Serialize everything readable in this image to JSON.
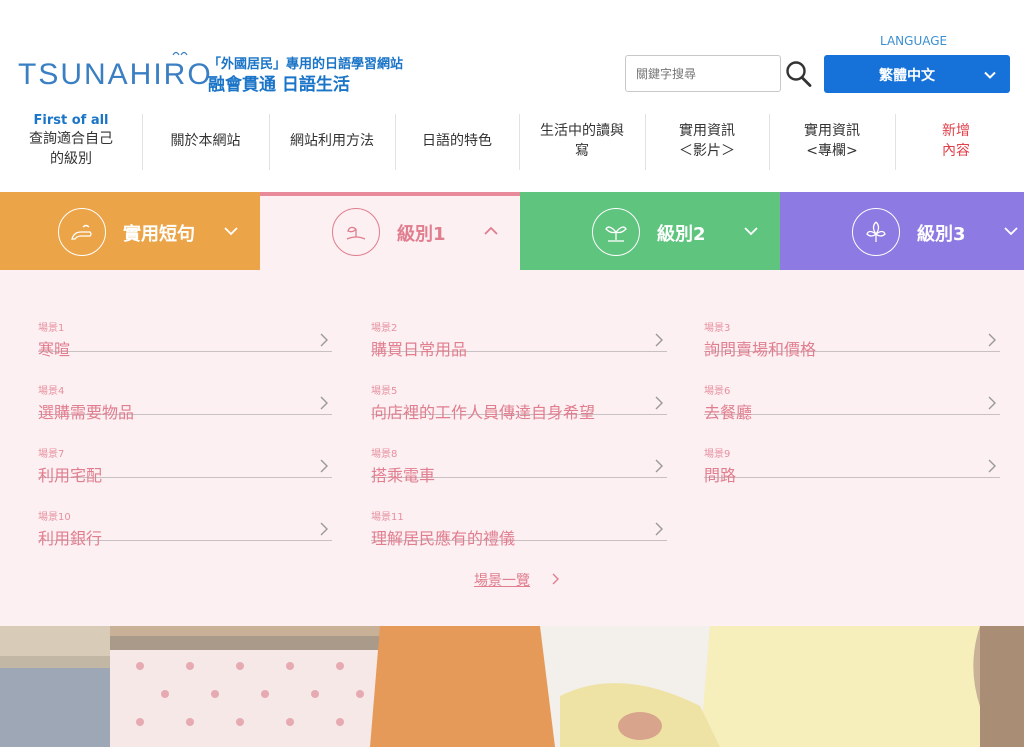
{
  "header": {
    "logo": "TSUNAHIRO",
    "tagline_line1": "「外國居民」專用的日語學習網站",
    "tagline_line2": "融會貫通 日語生活",
    "search_placeholder": "關鍵字搜尋",
    "language_label": "LANGUAGE",
    "language_selected": "繁體中文"
  },
  "nav": [
    {
      "pre": "First of all",
      "label": "查詢適合自己",
      "label2": "的級別"
    },
    {
      "label": "關於本網站"
    },
    {
      "label": "網站利用方法"
    },
    {
      "label": "日語的特色"
    },
    {
      "label": "生活中的讀與",
      "label2": "寫"
    },
    {
      "label": "實用資訊",
      "label2": "＜影片＞"
    },
    {
      "label": "實用資訊",
      "label2": "<專欄>"
    },
    {
      "label": "新增",
      "label2": "內容"
    }
  ],
  "tabs": [
    {
      "label": "實用短句",
      "icon": "speech-icon"
    },
    {
      "label": "級別1",
      "icon": "sprout-icon"
    },
    {
      "label": "級別2",
      "icon": "seedling-icon"
    },
    {
      "label": "級別3",
      "icon": "tree-icon"
    }
  ],
  "scenes": [
    {
      "num": "場景1",
      "title": "寒暄"
    },
    {
      "num": "場景2",
      "title": "購買日常用品"
    },
    {
      "num": "場景3",
      "title": "詢問賣場和價格"
    },
    {
      "num": "場景4",
      "title": "選購需要物品"
    },
    {
      "num": "場景5",
      "title": "向店裡的工作人員傳達自身希望"
    },
    {
      "num": "場景6",
      "title": "去餐廳"
    },
    {
      "num": "場景7",
      "title": "利用宅配"
    },
    {
      "num": "場景8",
      "title": "搭乘電車"
    },
    {
      "num": "場景9",
      "title": "問路"
    },
    {
      "num": "場景10",
      "title": "利用銀行"
    },
    {
      "num": "場景11",
      "title": "理解居民應有的禮儀"
    }
  ],
  "see_all": "場景一覽",
  "colors": {
    "brand_blue": "#1a74c7",
    "lang_button": "#1672d9",
    "tab_orange": "#eba448",
    "tab_pink_text": "#e07d8e",
    "tab_green": "#5ec47e",
    "tab_purple": "#8d7ae2",
    "panel_bg": "#fdf0f2"
  }
}
